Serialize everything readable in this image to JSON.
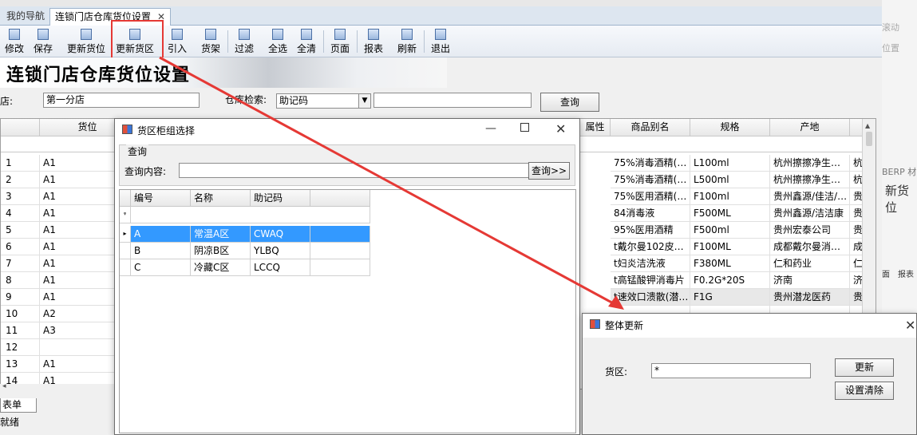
{
  "tabs": [
    {
      "label": "我的导航"
    },
    {
      "label": "连锁门店仓库货位设置",
      "close": "✕"
    }
  ],
  "toolbar": [
    {
      "label": "修改",
      "icon": "edit-icon"
    },
    {
      "label": "保存",
      "icon": "save-icon"
    },
    {
      "label": "更新货位",
      "icon": "update-location-icon"
    },
    {
      "label": "更新货区",
      "icon": "update-zone-icon"
    },
    {
      "label": "引入",
      "icon": "import-icon"
    },
    {
      "label": "货架",
      "icon": "shelf-icon"
    },
    {
      "label": "过滤",
      "icon": "binoculars-icon"
    },
    {
      "label": "全选",
      "icon": "select-all-icon"
    },
    {
      "label": "全清",
      "icon": "clear-all-icon"
    },
    {
      "label": "页面",
      "icon": "page-icon"
    },
    {
      "label": "报表",
      "icon": "report-icon"
    },
    {
      "label": "刷新",
      "icon": "refresh-icon"
    },
    {
      "label": "退出",
      "icon": "exit-icon"
    }
  ],
  "banner": {
    "title": "连锁门店仓库货位设置"
  },
  "search": {
    "store_label": "门店:",
    "store_value": "第一分店",
    "warehouse_label": "仓库检索:",
    "search_mode": "助记码",
    "query_button": "查询"
  },
  "grid": {
    "headers": [
      "货位",
      "属性",
      "商品别名",
      "规格",
      "产地"
    ],
    "rows": [
      {
        "n": "1",
        "loc": "A1",
        "alias": "75%消毒酒精(…",
        "spec": "L100ml",
        "origin": "杭州擦擦净生…",
        "x": "杭"
      },
      {
        "n": "2",
        "loc": "A1",
        "alias": "75%消毒酒精(…",
        "spec": "L500ml",
        "origin": "杭州擦擦净生…",
        "x": "杭"
      },
      {
        "n": "3",
        "loc": "A1",
        "alias": "75%医用酒精(…",
        "spec": "F100ml",
        "origin": "贵州鑫源/佳洁/…",
        "x": "贵"
      },
      {
        "n": "4",
        "loc": "A1",
        "alias": "84消毒液",
        "spec": "F500ML",
        "origin": "贵州鑫源/洁洁康",
        "x": "贵"
      },
      {
        "n": "5",
        "loc": "A1",
        "alias": "95%医用酒精",
        "spec": "F500ml",
        "origin": "贵州宏泰公司",
        "x": "贵"
      },
      {
        "n": "6",
        "loc": "A1",
        "alias": "t戴尔曼102皮…",
        "spec": "F100ML",
        "origin": "成都戴尔曼消…",
        "x": "成"
      },
      {
        "n": "7",
        "loc": "A1",
        "alias": "t妇炎洁洗液",
        "spec": "F380ML",
        "origin": "仁和药业",
        "x": "仁"
      },
      {
        "n": "8",
        "loc": "A1",
        "alias": "t高锰酸钾消毒片",
        "spec": "F0.2G*20S",
        "origin": "济南",
        "x": "济"
      },
      {
        "n": "9",
        "loc": "A1",
        "alias": "t速效口溃散(潜…",
        "spec": "F1G",
        "origin": "贵州潜龙医药",
        "x": "贵"
      },
      {
        "n": "10",
        "loc": "A2",
        "alias": "",
        "spec": "",
        "origin": "",
        "x": ""
      },
      {
        "n": "11",
        "loc": "A3",
        "alias": "",
        "spec": "",
        "origin": "",
        "x": ""
      },
      {
        "n": "12",
        "loc": "",
        "alias": "",
        "spec": "",
        "origin": "",
        "x": ""
      },
      {
        "n": "13",
        "loc": "A1",
        "alias": "",
        "spec": "",
        "origin": "",
        "x": ""
      },
      {
        "n": "14",
        "loc": "A1",
        "alias": "",
        "spec": "",
        "origin": "",
        "x": ""
      }
    ]
  },
  "bottom": {
    "tab": "表单",
    "status": "就绪"
  },
  "dialog_zone": {
    "title": "货区柜组选择",
    "group_title": "查询",
    "query_label": "查询内容:",
    "query_value": "",
    "query_button": "查询>>",
    "headers": [
      "编号",
      "名称",
      "助记码"
    ],
    "rows": [
      {
        "id": "A",
        "name": "常温A区",
        "code": "CWAQ",
        "selected": true
      },
      {
        "id": "B",
        "name": "阴凉B区",
        "code": "YLBQ",
        "selected": false
      },
      {
        "id": "C",
        "name": "冷藏C区",
        "code": "LCCQ",
        "selected": false
      }
    ]
  },
  "dialog_update": {
    "title": "整体更新",
    "zone_label": "货区:",
    "zone_value": "*",
    "update_button": "更新",
    "clear_button": "设置清除"
  },
  "background_right": [
    "滚动",
    "位置",
    "BERP 材",
    "新货位",
    "面",
    "报表"
  ],
  "colors": {
    "accent_red": "#e53935",
    "selection": "#3399ff"
  }
}
